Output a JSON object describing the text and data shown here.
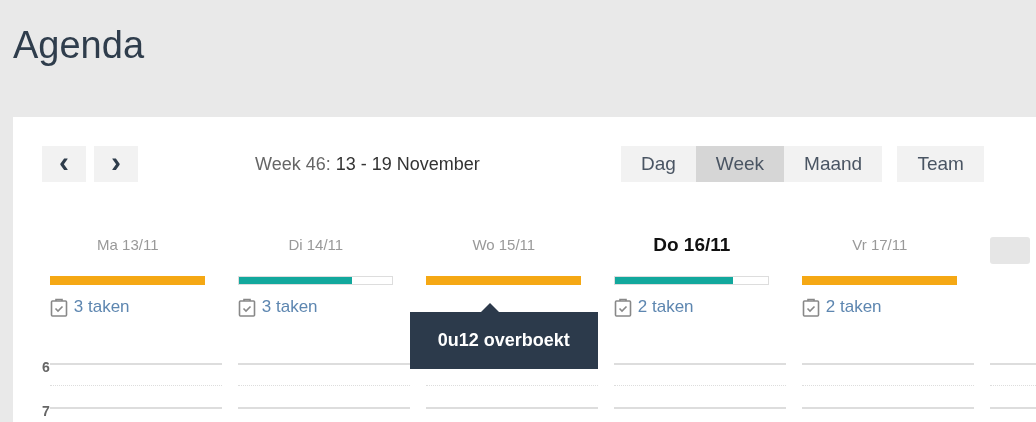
{
  "page": {
    "title": "Agenda"
  },
  "nav": {
    "prev": "‹",
    "next": "›",
    "range_prefix": "Week 46:",
    "range": "13 - 19 November"
  },
  "views": [
    {
      "label": "Dag",
      "selected": false
    },
    {
      "label": "Week",
      "selected": true
    },
    {
      "label": "Maand",
      "selected": false
    }
  ],
  "team_button": "Team",
  "days": [
    {
      "kind": "day",
      "label": "Ma 13/11",
      "today": false,
      "level": 1,
      "color": "#f5a814",
      "tasks": "3 taken"
    },
    {
      "kind": "day",
      "label": "Di 14/11",
      "today": false,
      "level": 0.74,
      "color": "#12a89d",
      "tasks": "3 taken"
    },
    {
      "kind": "day",
      "label": "Wo 15/11",
      "today": false,
      "level": 1,
      "color": "#f5a814",
      "tooltip": "0u12 overboekt"
    },
    {
      "kind": "day",
      "label": "Do 16/11",
      "today": true,
      "level": 0.77,
      "color": "#12a89d",
      "tasks": "2 taken"
    },
    {
      "kind": "day",
      "label": "Vr 17/11",
      "today": false,
      "level": 1,
      "color": "#f5a814",
      "tasks": "2 taken"
    },
    {
      "kind": "collapsed"
    }
  ],
  "hours": [
    "6",
    "7"
  ]
}
